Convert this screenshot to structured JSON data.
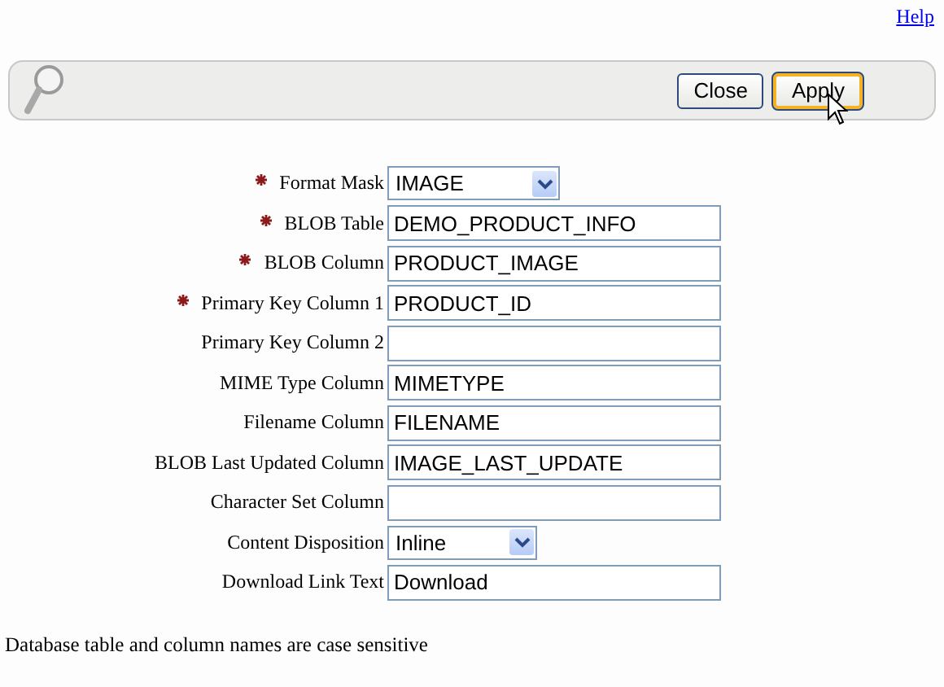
{
  "help_link": "Help",
  "toolbar": {
    "buttons": [
      {
        "label": "Close",
        "focused": false
      },
      {
        "label": "Apply",
        "focused": true
      }
    ]
  },
  "fields": [
    {
      "label": "Format Mask",
      "required": true,
      "kind": "select",
      "value": "IMAGE"
    },
    {
      "label": "BLOB Table",
      "required": true,
      "kind": "text",
      "value": "DEMO_PRODUCT_INFO"
    },
    {
      "label": "BLOB Column",
      "required": true,
      "kind": "text",
      "value": "PRODUCT_IMAGE"
    },
    {
      "label": "Primary Key Column 1",
      "required": true,
      "kind": "text",
      "value": "PRODUCT_ID"
    },
    {
      "label": "Primary Key Column 2",
      "required": false,
      "kind": "text"
    },
    {
      "label": "MIME Type Column",
      "required": false,
      "kind": "text",
      "value": "MIMETYPE"
    },
    {
      "label": "Filename Column",
      "required": false,
      "kind": "text",
      "value": "FILENAME"
    },
    {
      "label": "BLOB Last Updated Column",
      "required": false,
      "kind": "text",
      "value": "IMAGE_LAST_UPDATE"
    },
    {
      "label": "Character Set Column",
      "required": false,
      "kind": "text"
    },
    {
      "label": "Content Disposition",
      "required": false,
      "kind": "select",
      "value": "Inline"
    },
    {
      "label": "Download Link Text",
      "required": false,
      "kind": "text",
      "value": "Download"
    }
  ],
  "note": "Database table and column names are case sensitive"
}
